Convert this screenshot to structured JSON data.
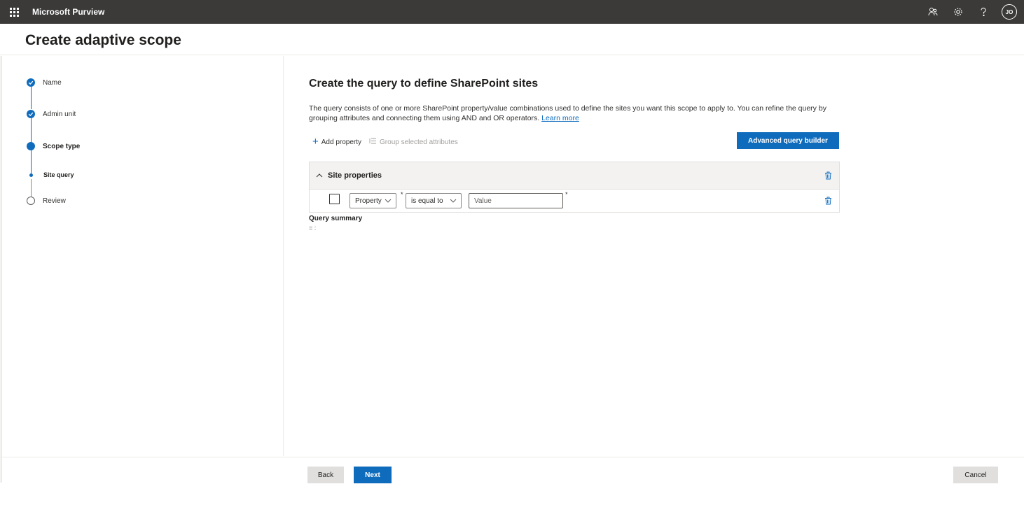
{
  "header": {
    "app_name": "Microsoft Purview",
    "avatar_initials": "JO",
    "icons": [
      "waffle-icon",
      "people-icon",
      "gear-icon",
      "help-icon"
    ]
  },
  "page": {
    "title": "Create adaptive scope"
  },
  "wizard": {
    "steps": [
      {
        "label": "Name",
        "state": "completed"
      },
      {
        "label": "Admin unit",
        "state": "completed"
      },
      {
        "label": "Scope type",
        "state": "current"
      },
      {
        "label": "Site query",
        "state": "current-substep"
      },
      {
        "label": "Review",
        "state": "not-started"
      }
    ]
  },
  "main": {
    "title": "Create the query to define SharePoint sites",
    "description": "The query consists of one or more SharePoint property/value combinations used to define the sites you want this scope to apply to. You can refine the query by grouping attributes and connecting them using AND and OR operators.",
    "learn_more": "Learn more",
    "toolbar": {
      "add_property": "Add property",
      "group_selected": "Group selected attributes",
      "advanced_query_builder": "Advanced query builder"
    },
    "group": {
      "title": "Site properties",
      "row": {
        "property_value": "Property",
        "operator_value": "is equal to",
        "value_placeholder": "Value",
        "required_mark": "*"
      }
    },
    "query_summary": {
      "title": "Query summary",
      "value": "= :"
    }
  },
  "footer": {
    "back": "Back",
    "next": "Next",
    "cancel": "Cancel"
  },
  "colors": {
    "accent": "#0f6cbd",
    "topbar": "#3b3a39"
  }
}
